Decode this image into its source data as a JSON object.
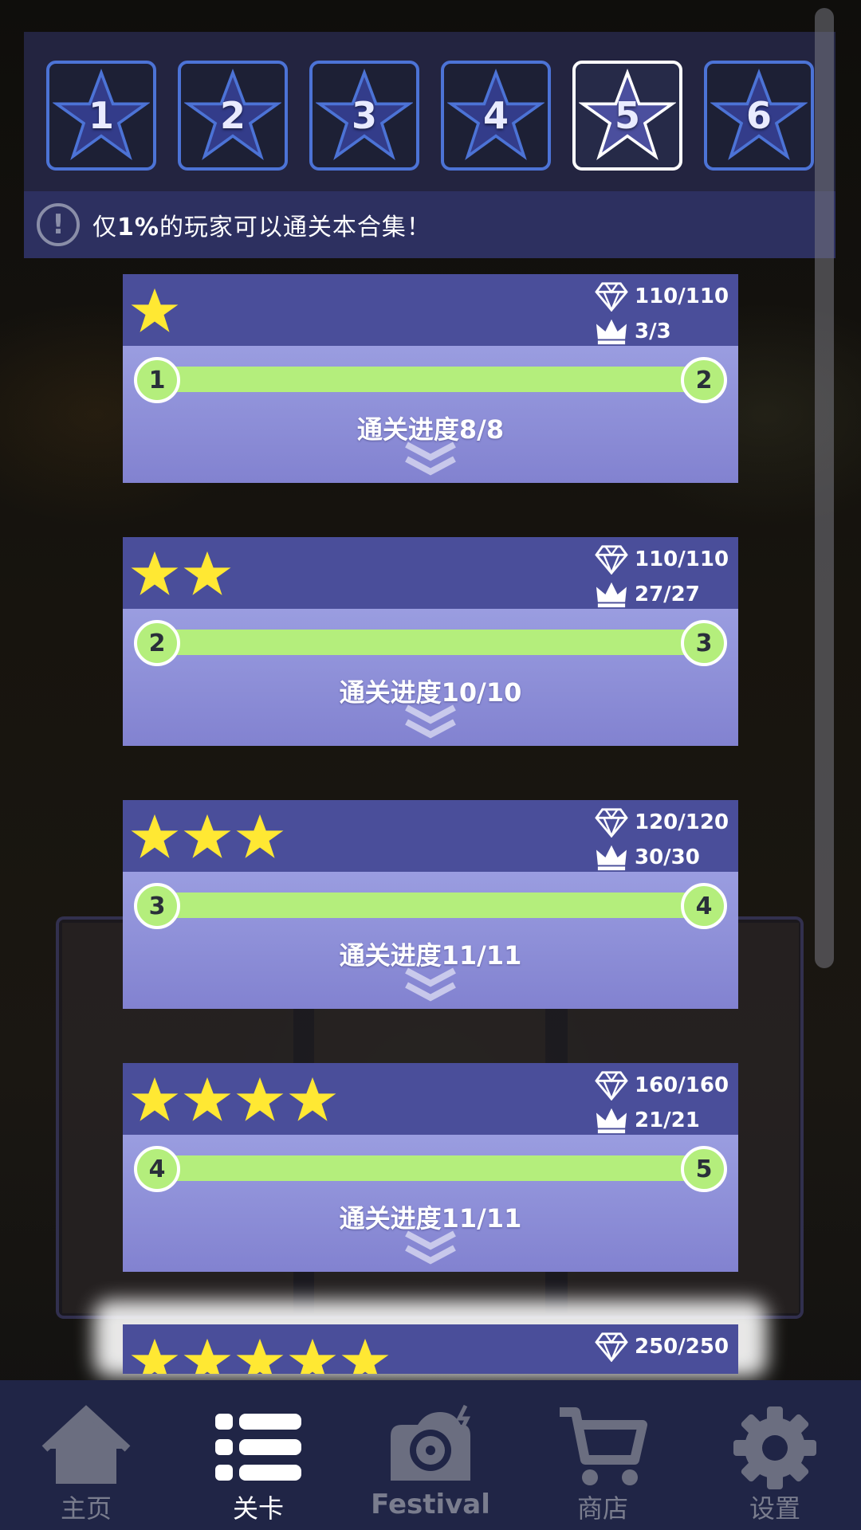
{
  "level_tabs": [
    {
      "number": "1",
      "selected": false
    },
    {
      "number": "2",
      "selected": false
    },
    {
      "number": "3",
      "selected": false
    },
    {
      "number": "4",
      "selected": false
    },
    {
      "number": "5",
      "selected": true
    },
    {
      "number": "6",
      "selected": false
    }
  ],
  "notice": {
    "icon": "exclamation-icon",
    "prefix": "仅",
    "highlight": "1%",
    "suffix": "的玩家可以通关本合集！"
  },
  "cards": [
    {
      "stars": 1,
      "diamonds": "110/110",
      "crowns": "3/3",
      "from_level": "1",
      "to_level": "2",
      "progress_label": "通关进度",
      "progress_value": "8/8"
    },
    {
      "stars": 2,
      "diamonds": "110/110",
      "crowns": "27/27",
      "from_level": "2",
      "to_level": "3",
      "progress_label": "通关进度",
      "progress_value": "10/10"
    },
    {
      "stars": 3,
      "diamonds": "120/120",
      "crowns": "30/30",
      "from_level": "3",
      "to_level": "4",
      "progress_label": "通关进度",
      "progress_value": "11/11"
    },
    {
      "stars": 4,
      "diamonds": "160/160",
      "crowns": "21/21",
      "from_level": "4",
      "to_level": "5",
      "progress_label": "通关进度",
      "progress_value": "11/11"
    },
    {
      "stars": 5,
      "diamonds": "250/250"
    }
  ],
  "nav": [
    {
      "label": "主页",
      "icon": "home-icon",
      "active": false
    },
    {
      "label": "关卡",
      "icon": "list-icon",
      "active": true
    },
    {
      "label": "Festival",
      "icon": "record-player-icon",
      "active": false
    },
    {
      "label": "商店",
      "icon": "cart-icon",
      "active": false
    },
    {
      "label": "设置",
      "icon": "gear-icon",
      "active": false
    }
  ],
  "colors": {
    "accent_green": "#b4ee7c",
    "star_yellow": "#ffe833",
    "card_header": "#4a4e9a",
    "card_body": "#9a9de0",
    "tab_border": "#4c73d6",
    "nav_bg": "#202546"
  }
}
